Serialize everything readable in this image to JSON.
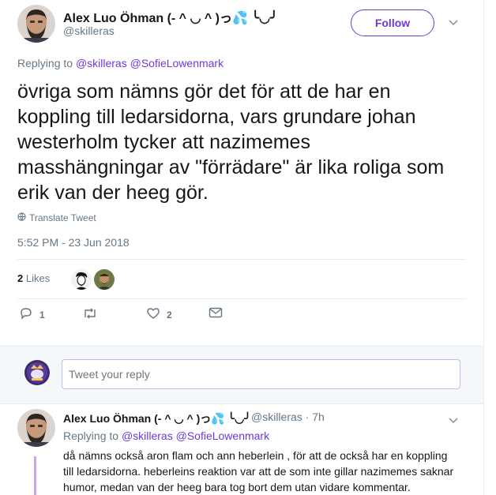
{
  "tweet": {
    "author_name": "Alex Luo Öhman (- ^ ◡ ^ )っ💦 ╰◡╯",
    "author_handle": "@skilleras",
    "follow_label": "Follow",
    "replying_prefix": "Replying to",
    "replying_to_1": "@skilleras",
    "replying_to_2": "@SofieLowenmark",
    "text": "övriga som nämns gör det för att de har en koppling till ledarsidorna, vars grundare johan westerholm tycker att nazimemes masshängningar av \"förrädare\" är lika roliga som erik van der heeg gör.",
    "translate_label": "Translate Tweet",
    "timestamp": "5:52 PM - 23 Jun 2018",
    "likes_count": "2",
    "likes_label": "Likes",
    "actions": {
      "reply_count": "1",
      "retweet_count": "",
      "like_count": "2"
    }
  },
  "reply_box": {
    "placeholder": "Tweet your reply"
  },
  "reply_tweet": {
    "author_name": "Alex Luo Öhman (- ^ ◡ ^ )っ💦 ╰◡╯",
    "author_handle": "@skilleras",
    "separator": "·",
    "time_ago": "7h",
    "replying_prefix": "Replying to",
    "replying_to_1": "@skilleras",
    "replying_to_2": "@SofieLowenmark",
    "text": "då nämns också aron flam och ann heberlein , för att de också har en koppling till ledarsidorna. heberleins reaktion var att de som inte gillar nazimemes saknar humor, medan van der heeg bara tog bort dem utan vidare kommentar."
  },
  "colors": {
    "accent": "#6e39d6",
    "muted": "#657786",
    "thread_line": "#c6a6f1"
  },
  "icons": [
    "chevron-down-icon",
    "globe-icon",
    "reply-icon",
    "retweet-icon",
    "heart-icon",
    "envelope-icon"
  ]
}
